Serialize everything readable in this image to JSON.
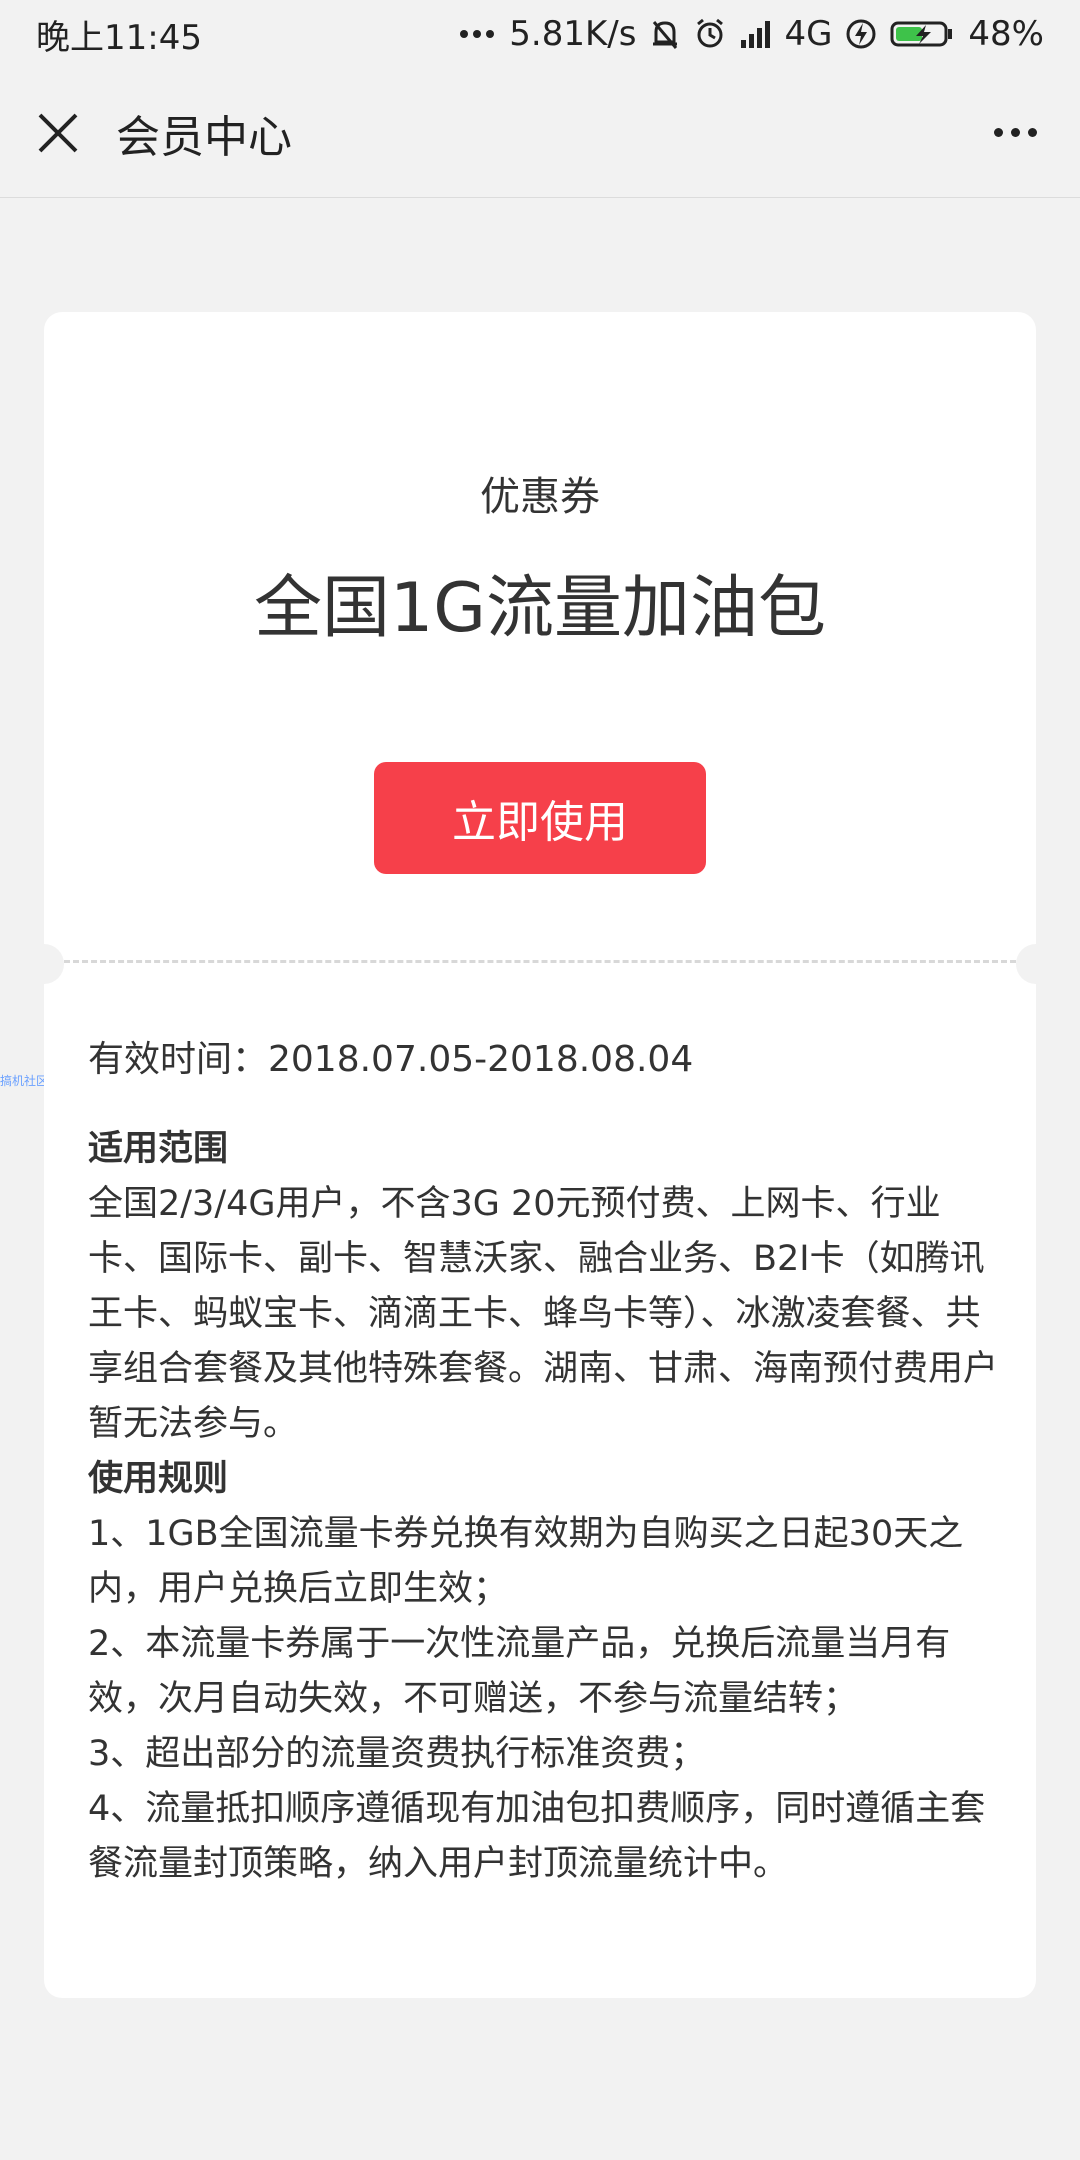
{
  "status_bar": {
    "time": "晚上11:45",
    "network_speed": "5.81K/s",
    "network_type": "4G",
    "battery": "48%",
    "icons": [
      "more-dots-icon",
      "mute-bell-icon",
      "alarm-icon",
      "signal-icon",
      "charging-icon",
      "battery-icon"
    ]
  },
  "nav": {
    "close_icon": "close-icon",
    "title": "会员中心",
    "more_icon": "more-icon"
  },
  "coupon": {
    "label": "优惠券",
    "title": "全国1G流量加油包",
    "use_button": "立即使用",
    "button_color": "#f6404a"
  },
  "details": {
    "valid_time": "有效时间：2018.07.05-2018.08.04",
    "scope_heading": "适用范围",
    "scope_text": "全国2/3/4G用户，不含3G 20元预付费、上网卡、行业卡、国际卡、副卡、智慧沃家、融合业务、B2I卡（如腾讯王卡、蚂蚁宝卡、滴滴王卡、蜂鸟卡等）、冰激凌套餐、共享组合套餐及其他特殊套餐。湖南、甘肃、海南预付费用户暂无法参与。",
    "rules_heading": "使用规则",
    "rules": [
      "1、1GB全国流量卡券兑换有效期为自购买之日起30天之内，用户兑换后立即生效；",
      "2、本流量卡券属于一次性流量产品，兑换后流量当月有效，次月自动失效，不可赠送，不参与流量结转；",
      "3、超出部分的流量资费执行标准资费；",
      "4、流量抵扣顺序遵循现有加油包扣费顺序，同时遵循主套餐流量封顶策略，纳入用户封顶流量统计中。"
    ]
  },
  "watermark": "搞机社区"
}
